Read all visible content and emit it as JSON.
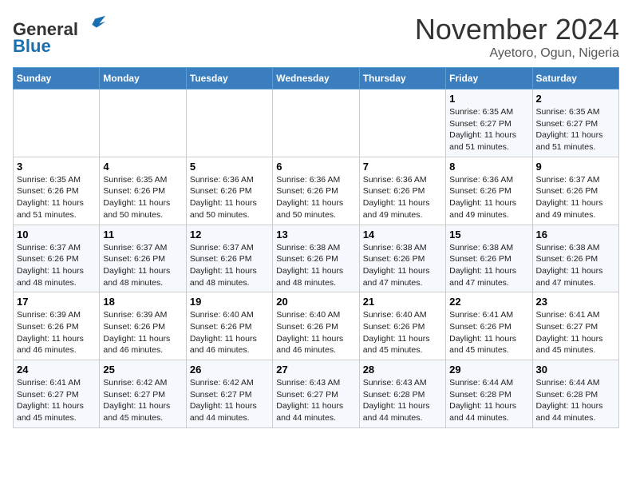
{
  "header": {
    "logo_line1": "General",
    "logo_line2": "Blue",
    "month_title": "November 2024",
    "location": "Ayetoro, Ogun, Nigeria"
  },
  "weekdays": [
    "Sunday",
    "Monday",
    "Tuesday",
    "Wednesday",
    "Thursday",
    "Friday",
    "Saturday"
  ],
  "weeks": [
    [
      {
        "day": "",
        "info": ""
      },
      {
        "day": "",
        "info": ""
      },
      {
        "day": "",
        "info": ""
      },
      {
        "day": "",
        "info": ""
      },
      {
        "day": "",
        "info": ""
      },
      {
        "day": "1",
        "info": "Sunrise: 6:35 AM\nSunset: 6:27 PM\nDaylight: 11 hours and 51 minutes."
      },
      {
        "day": "2",
        "info": "Sunrise: 6:35 AM\nSunset: 6:27 PM\nDaylight: 11 hours and 51 minutes."
      }
    ],
    [
      {
        "day": "3",
        "info": "Sunrise: 6:35 AM\nSunset: 6:26 PM\nDaylight: 11 hours and 51 minutes."
      },
      {
        "day": "4",
        "info": "Sunrise: 6:35 AM\nSunset: 6:26 PM\nDaylight: 11 hours and 50 minutes."
      },
      {
        "day": "5",
        "info": "Sunrise: 6:36 AM\nSunset: 6:26 PM\nDaylight: 11 hours and 50 minutes."
      },
      {
        "day": "6",
        "info": "Sunrise: 6:36 AM\nSunset: 6:26 PM\nDaylight: 11 hours and 50 minutes."
      },
      {
        "day": "7",
        "info": "Sunrise: 6:36 AM\nSunset: 6:26 PM\nDaylight: 11 hours and 49 minutes."
      },
      {
        "day": "8",
        "info": "Sunrise: 6:36 AM\nSunset: 6:26 PM\nDaylight: 11 hours and 49 minutes."
      },
      {
        "day": "9",
        "info": "Sunrise: 6:37 AM\nSunset: 6:26 PM\nDaylight: 11 hours and 49 minutes."
      }
    ],
    [
      {
        "day": "10",
        "info": "Sunrise: 6:37 AM\nSunset: 6:26 PM\nDaylight: 11 hours and 48 minutes."
      },
      {
        "day": "11",
        "info": "Sunrise: 6:37 AM\nSunset: 6:26 PM\nDaylight: 11 hours and 48 minutes."
      },
      {
        "day": "12",
        "info": "Sunrise: 6:37 AM\nSunset: 6:26 PM\nDaylight: 11 hours and 48 minutes."
      },
      {
        "day": "13",
        "info": "Sunrise: 6:38 AM\nSunset: 6:26 PM\nDaylight: 11 hours and 48 minutes."
      },
      {
        "day": "14",
        "info": "Sunrise: 6:38 AM\nSunset: 6:26 PM\nDaylight: 11 hours and 47 minutes."
      },
      {
        "day": "15",
        "info": "Sunrise: 6:38 AM\nSunset: 6:26 PM\nDaylight: 11 hours and 47 minutes."
      },
      {
        "day": "16",
        "info": "Sunrise: 6:38 AM\nSunset: 6:26 PM\nDaylight: 11 hours and 47 minutes."
      }
    ],
    [
      {
        "day": "17",
        "info": "Sunrise: 6:39 AM\nSunset: 6:26 PM\nDaylight: 11 hours and 46 minutes."
      },
      {
        "day": "18",
        "info": "Sunrise: 6:39 AM\nSunset: 6:26 PM\nDaylight: 11 hours and 46 minutes."
      },
      {
        "day": "19",
        "info": "Sunrise: 6:40 AM\nSunset: 6:26 PM\nDaylight: 11 hours and 46 minutes."
      },
      {
        "day": "20",
        "info": "Sunrise: 6:40 AM\nSunset: 6:26 PM\nDaylight: 11 hours and 46 minutes."
      },
      {
        "day": "21",
        "info": "Sunrise: 6:40 AM\nSunset: 6:26 PM\nDaylight: 11 hours and 45 minutes."
      },
      {
        "day": "22",
        "info": "Sunrise: 6:41 AM\nSunset: 6:26 PM\nDaylight: 11 hours and 45 minutes."
      },
      {
        "day": "23",
        "info": "Sunrise: 6:41 AM\nSunset: 6:27 PM\nDaylight: 11 hours and 45 minutes."
      }
    ],
    [
      {
        "day": "24",
        "info": "Sunrise: 6:41 AM\nSunset: 6:27 PM\nDaylight: 11 hours and 45 minutes."
      },
      {
        "day": "25",
        "info": "Sunrise: 6:42 AM\nSunset: 6:27 PM\nDaylight: 11 hours and 45 minutes."
      },
      {
        "day": "26",
        "info": "Sunrise: 6:42 AM\nSunset: 6:27 PM\nDaylight: 11 hours and 44 minutes."
      },
      {
        "day": "27",
        "info": "Sunrise: 6:43 AM\nSunset: 6:27 PM\nDaylight: 11 hours and 44 minutes."
      },
      {
        "day": "28",
        "info": "Sunrise: 6:43 AM\nSunset: 6:28 PM\nDaylight: 11 hours and 44 minutes."
      },
      {
        "day": "29",
        "info": "Sunrise: 6:44 AM\nSunset: 6:28 PM\nDaylight: 11 hours and 44 minutes."
      },
      {
        "day": "30",
        "info": "Sunrise: 6:44 AM\nSunset: 6:28 PM\nDaylight: 11 hours and 44 minutes."
      }
    ]
  ]
}
